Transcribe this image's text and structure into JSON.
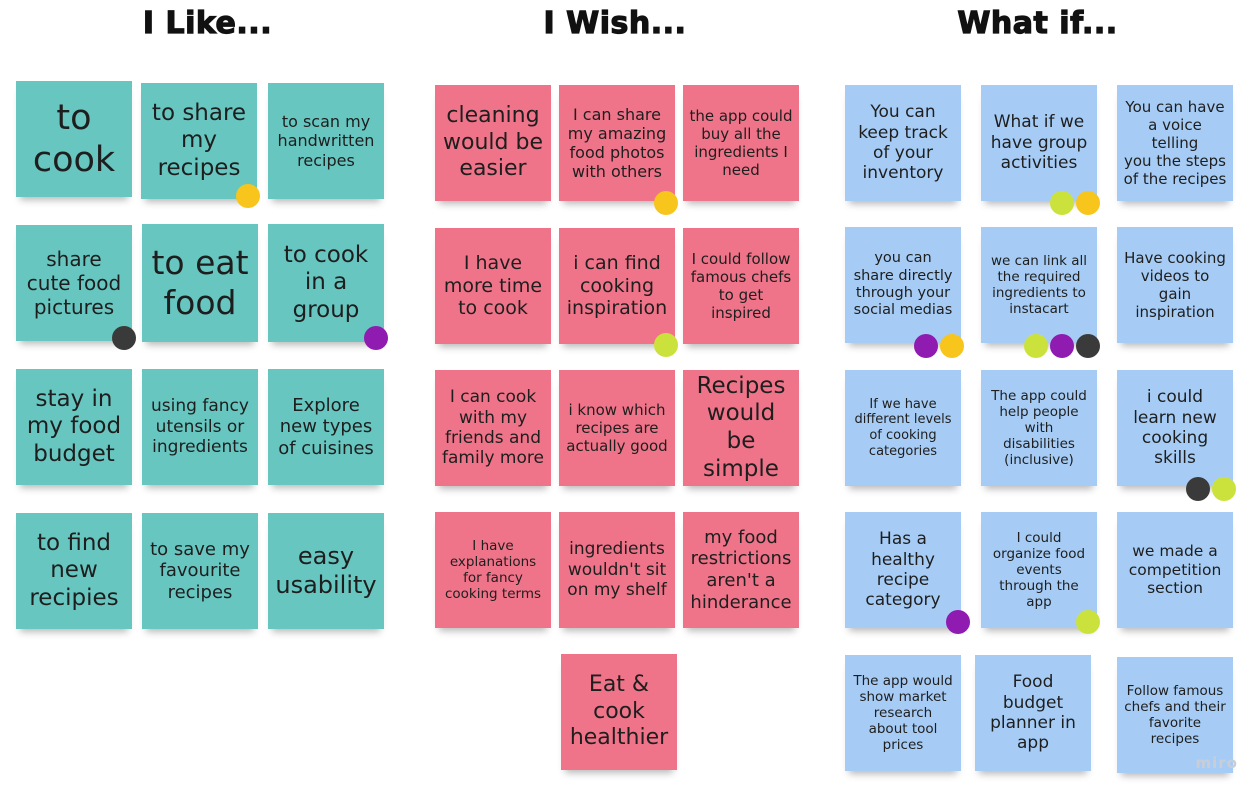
{
  "columns": {
    "like": "I Like...",
    "wish": "I Wish...",
    "whatif": "What if..."
  },
  "colors": {
    "teal_note": "#67c6c0",
    "pink_note": "#ef7489",
    "blue_note": "#a6ccf5",
    "dot_yellow": "#f7c51c",
    "dot_purple": "#8f1bb0",
    "dot_lime": "#cce23c",
    "dot_dark": "#3a3a3a"
  },
  "like_notes": [
    "to\ncook",
    "to share\nmy\nrecipes",
    "to scan my\nhandwritten\nrecipes",
    "share\ncute food\npictures",
    "to eat\nfood",
    "to cook\nin a\ngroup",
    "stay in\nmy food\nbudget",
    "using fancy\nutensils or\ningredients",
    "Explore\nnew types\nof cuisines",
    "to find\nnew\nrecipies",
    "to save my\nfavourite\nrecipes",
    "easy\nusability"
  ],
  "wish_notes": [
    "cleaning\nwould be\neasier",
    "I can share\nmy amazing\nfood photos\nwith others",
    "the app could\nbuy all the\ningredients I\nneed",
    "I have\nmore time\nto cook",
    "i can find\ncooking\ninspiration",
    "I could follow\nfamous chefs\nto get\ninspired",
    "I can cook\nwith my\nfriends and\nfamily more",
    "i know which\nrecipes are\nactually good",
    "Recipes\nwould be\nsimple",
    "I have\nexplanations\nfor fancy\ncooking terms",
    "ingredients\nwouldn't sit\non my shelf",
    "my food\nrestrictions\naren't a\nhinderance",
    "Eat &\ncook\nhealthier"
  ],
  "whatif_notes": [
    "You can\nkeep track\nof your\ninventory",
    "What if we\nhave group\nactivities",
    "You can have\na voice telling\nyou the steps\nof the recipes",
    "you can\nshare directly\nthrough your\nsocial medias",
    "we can link all\nthe required\ningredients to\ninstacart",
    "Have cooking\nvideos to gain\ninspiration",
    "If we have\ndifferent levels\nof cooking\ncategories",
    "The app could\nhelp people\nwith\ndisabilities\n(inclusive)",
    "i could\nlearn new\ncooking\nskills",
    "Has a\nhealthy\nrecipe\ncategory",
    "I could\norganize food\nevents\nthrough the\napp",
    "we made a\ncompetition\nsection",
    "The app would\nshow market\nresearch\nabout tool\nprices",
    "Food\nbudget\nplanner in\napp",
    "Follow famous\nchefs and their\nfavorite\nrecipes"
  ],
  "watermark": "miro"
}
